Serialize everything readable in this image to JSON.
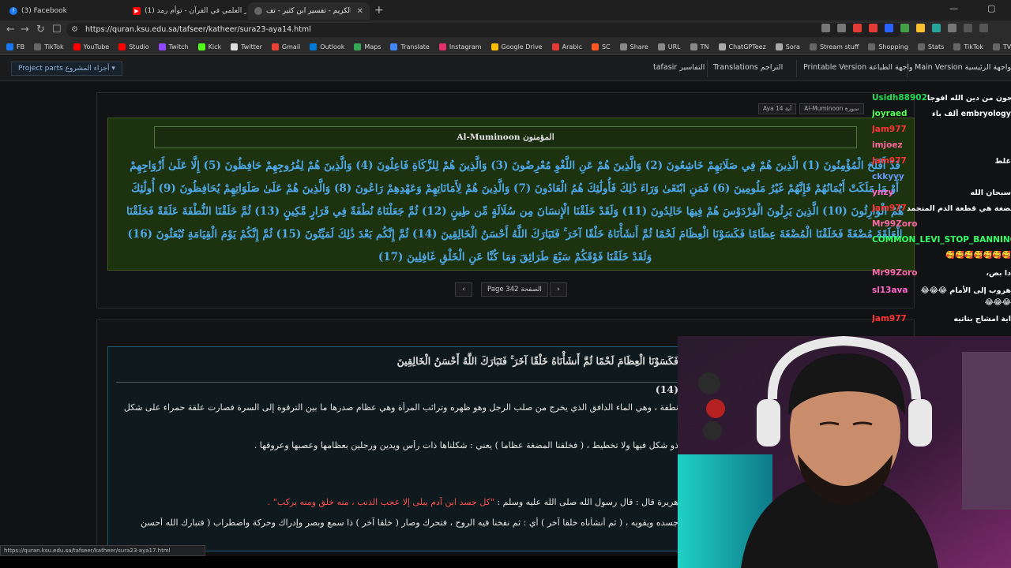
{
  "browser": {
    "tabs": [
      {
        "label": "(3) Facebook",
        "icon_color": "#1877f2"
      },
      {
        "label": "(1) الإعجاز العلمي في القرآن - توأم رمد...",
        "icon_color": "#ff0000"
      },
      {
        "label": "القرآن الكريم - تفسير ابن كثير - تف...",
        "icon_color": "#888888"
      }
    ],
    "new_tab": "+",
    "url": "https://quran.ksu.edu.sa/tafseer/katheer/sura23-aya14.html",
    "bookmarks": [
      {
        "label": "FB",
        "color": "#1877f2"
      },
      {
        "label": "TikTok",
        "color": "#666666"
      },
      {
        "label": "YouTube",
        "color": "#ff0000"
      },
      {
        "label": "Studio",
        "color": "#ff0000"
      },
      {
        "label": "Twitch",
        "color": "#9146ff"
      },
      {
        "label": "Kick",
        "color": "#53fc18"
      },
      {
        "label": "Twitter",
        "color": "#dddddd"
      },
      {
        "label": "Gmail",
        "color": "#ea4335"
      },
      {
        "label": "Outlook",
        "color": "#0078d4"
      },
      {
        "label": "Maps",
        "color": "#34a853"
      },
      {
        "label": "Translate",
        "color": "#4285f4"
      },
      {
        "label": "Instagram",
        "color": "#e1306c"
      },
      {
        "label": "Google Drive",
        "color": "#fbbc04"
      },
      {
        "label": "Arabic",
        "color": "#e53935"
      },
      {
        "label": "SC",
        "color": "#ff5722"
      },
      {
        "label": "Share",
        "color": "#888888"
      },
      {
        "label": "URL",
        "color": "#888888"
      },
      {
        "label": "TN",
        "color": "#888888"
      },
      {
        "label": "ChatGPTeez",
        "color": "#aaaaaa"
      },
      {
        "label": "Sora",
        "color": "#aaaaaa"
      },
      {
        "label": "Stream stuff",
        "color": "#666666"
      },
      {
        "label": "Shopping",
        "color": "#666666"
      },
      {
        "label": "Stats",
        "color": "#666666"
      },
      {
        "label": "TikTok",
        "color": "#666666"
      },
      {
        "label": "TV",
        "color": "#666666"
      },
      {
        "label": "Vids",
        "color": "#666666"
      }
    ],
    "status_url": "https://quran.ksu.edu.sa/tafseer/katheer/sura23-aya17.html"
  },
  "site": {
    "project_parts": "Project parts أجزاء المشروع",
    "tafasir": "tafasir التفاسير",
    "translations": "Translations التراجم",
    "printable": "Printable Version واجهة الطباعة",
    "main": "Main Version الواجهة الرئيسية"
  },
  "selectors": {
    "sura": "Al-Muminoon سورة",
    "aya": "Aya 14 آية"
  },
  "surah_title": "Al-Muminoon المؤمنون",
  "ayat_text": "قَدْ أَفْلَحَ الْمُؤْمِنُونَ (1) الَّذِينَ هُمْ فِي صَلَاتِهِمْ خَاشِعُونَ (2) وَالَّذِينَ هُمْ عَنِ اللَّغْوِ مُعْرِضُونَ (3) وَالَّذِينَ هُمْ لِلزَّكَاةِ فَاعِلُونَ (4) وَالَّذِينَ هُمْ لِفُرُوجِهِمْ حَافِظُونَ (5) إِلَّا عَلَىٰ أَزْوَاجِهِمْ أَوْ مَا مَلَكَتْ أَيْمَانُهُمْ فَإِنَّهُمْ غَيْرُ مَلُومِينَ (6) فَمَنِ ابْتَغَىٰ وَرَاءَ ذَٰلِكَ فَأُولَٰئِكَ هُمُ الْعَادُونَ (7) وَالَّذِينَ هُمْ لِأَمَانَاتِهِمْ وَعَهْدِهِمْ رَاعُونَ (8) وَالَّذِينَ هُمْ عَلَىٰ صَلَوَاتِهِمْ يُحَافِظُونَ (9) أُولَٰئِكَ هُمُ الْوَارِثُونَ (10) الَّذِينَ يَرِثُونَ الْفِرْدَوْسَ هُمْ فِيهَا خَالِدُونَ (11) وَلَقَدْ خَلَقْنَا الْإِنسَانَ مِن سُلَالَةٍ مِّن طِينٍ (12) ثُمَّ جَعَلْنَاهُ نُطْفَةً فِي قَرَارٍ مَّكِينٍ (13) ثُمَّ خَلَقْنَا النُّطْفَةَ عَلَقَةً فَخَلَقْنَا الْعَلَقَةَ مُضْغَةً فَخَلَقْنَا الْمُضْغَةَ عِظَامًا فَكَسَوْنَا الْعِظَامَ لَحْمًا ثُمَّ أَنشَأْنَاهُ خَلْقًا آخَرَ ۚ فَتَبَارَكَ اللَّهُ أَحْسَنُ الْخَالِقِينَ (14) ثُمَّ إِنَّكُم بَعْدَ ذَٰلِكَ لَمَيِّتُونَ (15) ثُمَّ إِنَّكُمْ يَوْمَ الْقِيَامَةِ تُبْعَثُونَ (16) وَلَقَدْ خَلَقْنَا فَوْقَكُمْ سَبْعَ طَرَائِقَ وَمَا كُنَّا عَنِ الْخَلْقِ غَافِلِينَ (17)",
  "pager": {
    "prev": "‹",
    "next": "›",
    "label": "Page 342 الصفحة"
  },
  "tafsir": {
    "heading": "فَكَسَوْنَا الْعِظَامَ لَحْمًا ثُمَّ أَنشَأْنَاهُ خَلْقًا آخَرَ ۚ فَتَبَارَكَ اللَّهُ أَحْسَنُ الْخَالِقِينَ (14)",
    "p1": "نطفة ، وهي الماء الدافق الذي يخرج من صلب الرجل وهو ظهره وترائب المرأة وهي عظام صدرها ما بين الترقوة إلى السرة فصارت علقة حمراء على شكل",
    "p2": "ذو شكل فيها ولا تخطيط ، ( فخلقنا المضغة عظاما ) يعني : شكلناها ذات رأس ويدين ورجلين بعظامها وعصبها وعروقها .",
    "p3a": "هريرة قال : قال رسول الله صلى الله عليه وسلم : ",
    "p3b": "\"كل جسد ابن آدم يبلى إلا عجب الذنب ، منه خلق ومنه يركب\" .",
    "p4": "جسده ويقويه ، ( ثم أنشأناه خلقا آخر ) أي : ثم نفخنا فيه الروح ، فتحرك وصار ( خلقا آخر ) ذا سمع وبصر وإدراك وحركة واضطراب ( فتبارك الله أحسن"
  },
  "chat": [
    {
      "user": "Usidh88902",
      "color": "#22dd55",
      "text": "يخرجون من دين الله افوجا"
    },
    {
      "user": "joyraed",
      "color": "#55ff55",
      "text": "embryology ألف باء"
    },
    {
      "user": "Jam977",
      "color": "#ff3333",
      "text": ""
    },
    {
      "user": "imjoez",
      "color": "#ff6699",
      "text": ""
    },
    {
      "user": "Jam977",
      "color": "#ff3333",
      "text": "غلط"
    },
    {
      "user": "ckkyyy",
      "color": "#6699ff",
      "text": ""
    },
    {
      "user": "ynzy",
      "color": "#ff66cc",
      "text": "سبحان الله"
    },
    {
      "user": "Jam977",
      "color": "#ff3333",
      "text": "المضغة هي قطعة الدم المتجمد"
    },
    {
      "user": "Mr99Zoro",
      "color": "#ff66aa",
      "text": ""
    },
    {
      "user": "COMMON_LEVI_STOP_BANNING",
      "color": "#33ff66",
      "text": ""
    },
    {
      "user": "",
      "color": "#ffcc33",
      "text": "🥰🥰🥰🥰🥰🥰🥰"
    },
    {
      "user": "Mr99Zoro",
      "color": "#ff66aa",
      "text": "دا بص،"
    },
    {
      "user": "sl13ava",
      "color": "#ff66cc",
      "text": "هروب إلى الأمام 😂😂😂"
    },
    {
      "user": "",
      "color": "#ffcc33",
      "text": "😂😂😂"
    },
    {
      "user": "Jam977",
      "color": "#ff3333",
      "text": "اية امشاج بتاتيه"
    }
  ]
}
